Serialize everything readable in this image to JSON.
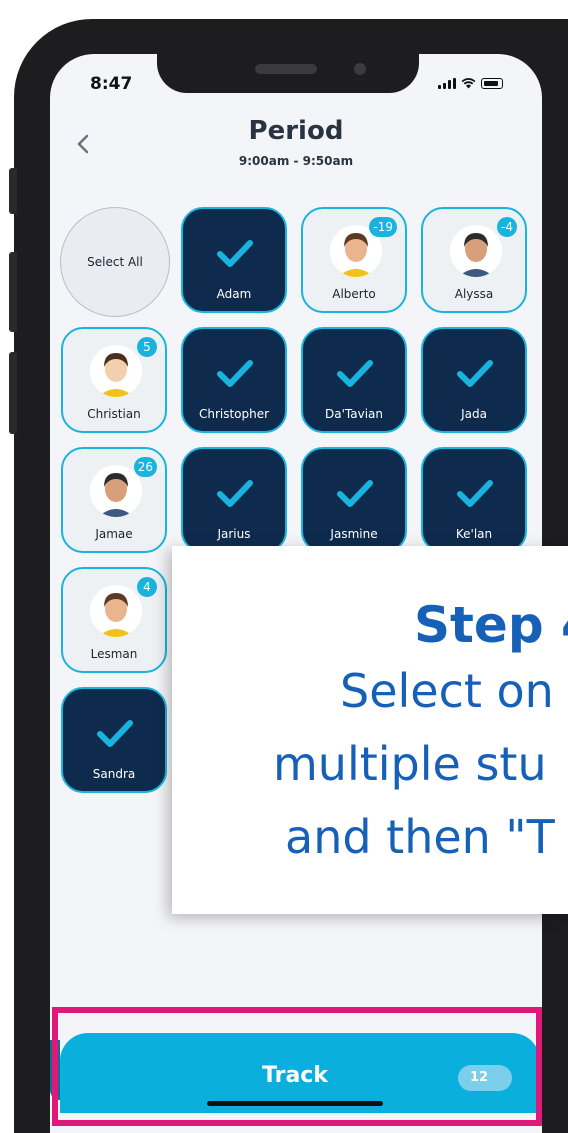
{
  "status_bar": {
    "time": "8:47"
  },
  "header": {
    "title": "Period",
    "subtitle": "9:00am - 9:50am"
  },
  "select_all_label": "Select All",
  "students": [
    {
      "name": "Adam",
      "selected": true
    },
    {
      "name": "Alberto",
      "selected": false,
      "badge": "-19"
    },
    {
      "name": "Alyssa",
      "selected": false,
      "badge": "-4"
    },
    {
      "name": "Christian",
      "selected": false,
      "badge": "5"
    },
    {
      "name": "Christopher",
      "selected": true
    },
    {
      "name": "Da'Tavian",
      "selected": true
    },
    {
      "name": "Jada",
      "selected": true
    },
    {
      "name": "Jamae",
      "selected": false,
      "badge": "26"
    },
    {
      "name": "Jarius",
      "selected": true
    },
    {
      "name": "Jasmine",
      "selected": true
    },
    {
      "name": "Ke'lan",
      "selected": true
    },
    {
      "name": "Lesman",
      "selected": false,
      "badge": "4"
    },
    {
      "name": "Sandra",
      "selected": true
    }
  ],
  "overlay": {
    "step": "Step 4",
    "line1": "Select on",
    "line2": "multiple stu",
    "line3": "and then \"T"
  },
  "track_button": {
    "label": "Track",
    "count": "12"
  },
  "colors": {
    "accent": "#19b4dd",
    "selected_tile": "#0e2b4e",
    "highlight": "#e0187a",
    "track": "#0aafde"
  }
}
